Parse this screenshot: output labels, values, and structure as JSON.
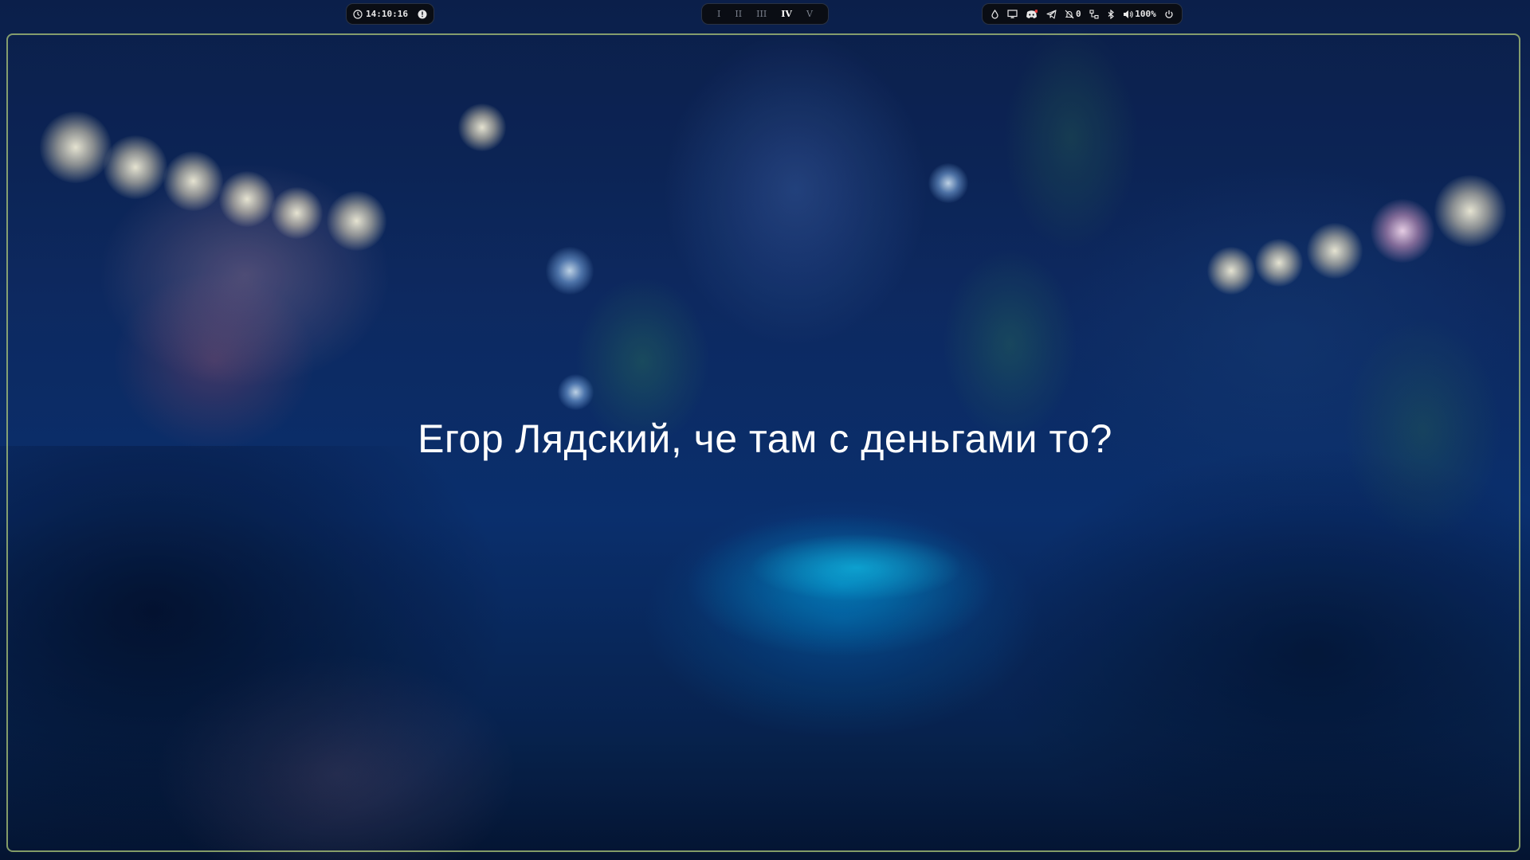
{
  "topbar": {
    "clock": {
      "time": "14:10:16",
      "clock_icon": "clock-icon",
      "info_icon": "info-circle-icon"
    },
    "workspaces": [
      {
        "label": "I",
        "active": false
      },
      {
        "label": "II",
        "active": false
      },
      {
        "label": "III",
        "active": false
      },
      {
        "label": "IV",
        "active": true
      },
      {
        "label": "V",
        "active": false
      }
    ],
    "tray": {
      "icons": [
        "droplet-icon",
        "monitor-icon",
        "discord-icon",
        "telegram-icon",
        "notifications-off-icon",
        "network-icon",
        "bluetooth-icon",
        "volume-icon",
        "power-icon"
      ],
      "notification_count": "0",
      "volume": "100%"
    }
  },
  "window": {
    "message": "Егор Лядский, че там с деньгами то?"
  },
  "colors": {
    "border": "#afc878",
    "bar_bg": "#0a0d14",
    "text": "#ffffff"
  }
}
